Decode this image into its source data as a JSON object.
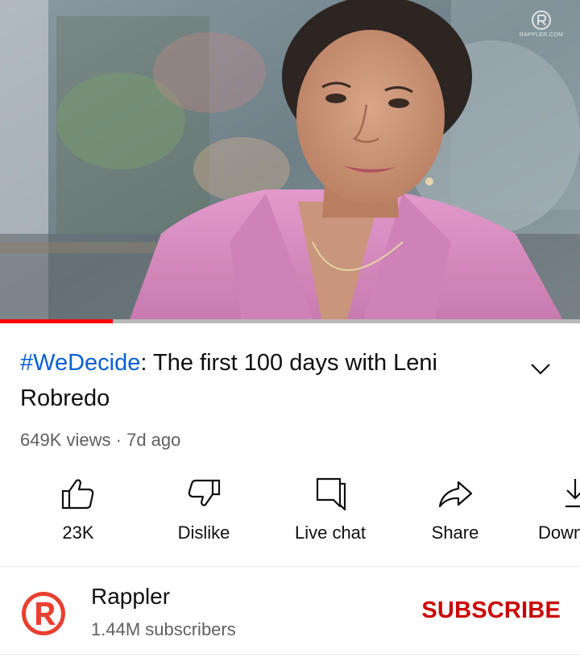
{
  "player": {
    "watermark_text": "RAPPLER.COM",
    "progress_fraction": 0.195
  },
  "video": {
    "hashtag": "#WeDecide",
    "title_rest": ": The first 100 days with Leni Robredo",
    "views": "649K views",
    "separator": "·",
    "age": "7d ago"
  },
  "actions": [
    {
      "icon": "thumbs-up-icon",
      "label": "23K"
    },
    {
      "icon": "thumbs-down-icon",
      "label": "Dislike"
    },
    {
      "icon": "live-chat-icon",
      "label": "Live chat"
    },
    {
      "icon": "share-icon",
      "label": "Share"
    },
    {
      "icon": "download-icon",
      "label": "Down"
    }
  ],
  "channel": {
    "name": "Rappler",
    "subscribers": "1.44M subscribers",
    "subscribe_label": "SUBSCRIBE",
    "avatar_icon": "rappler-logo-icon"
  },
  "colors": {
    "accent_red": "#ff0000",
    "subscribe_red": "#cc0000",
    "hashtag_blue": "#065fd4",
    "secondary_text": "#606060",
    "jacket_pink": "#d98bbd"
  }
}
